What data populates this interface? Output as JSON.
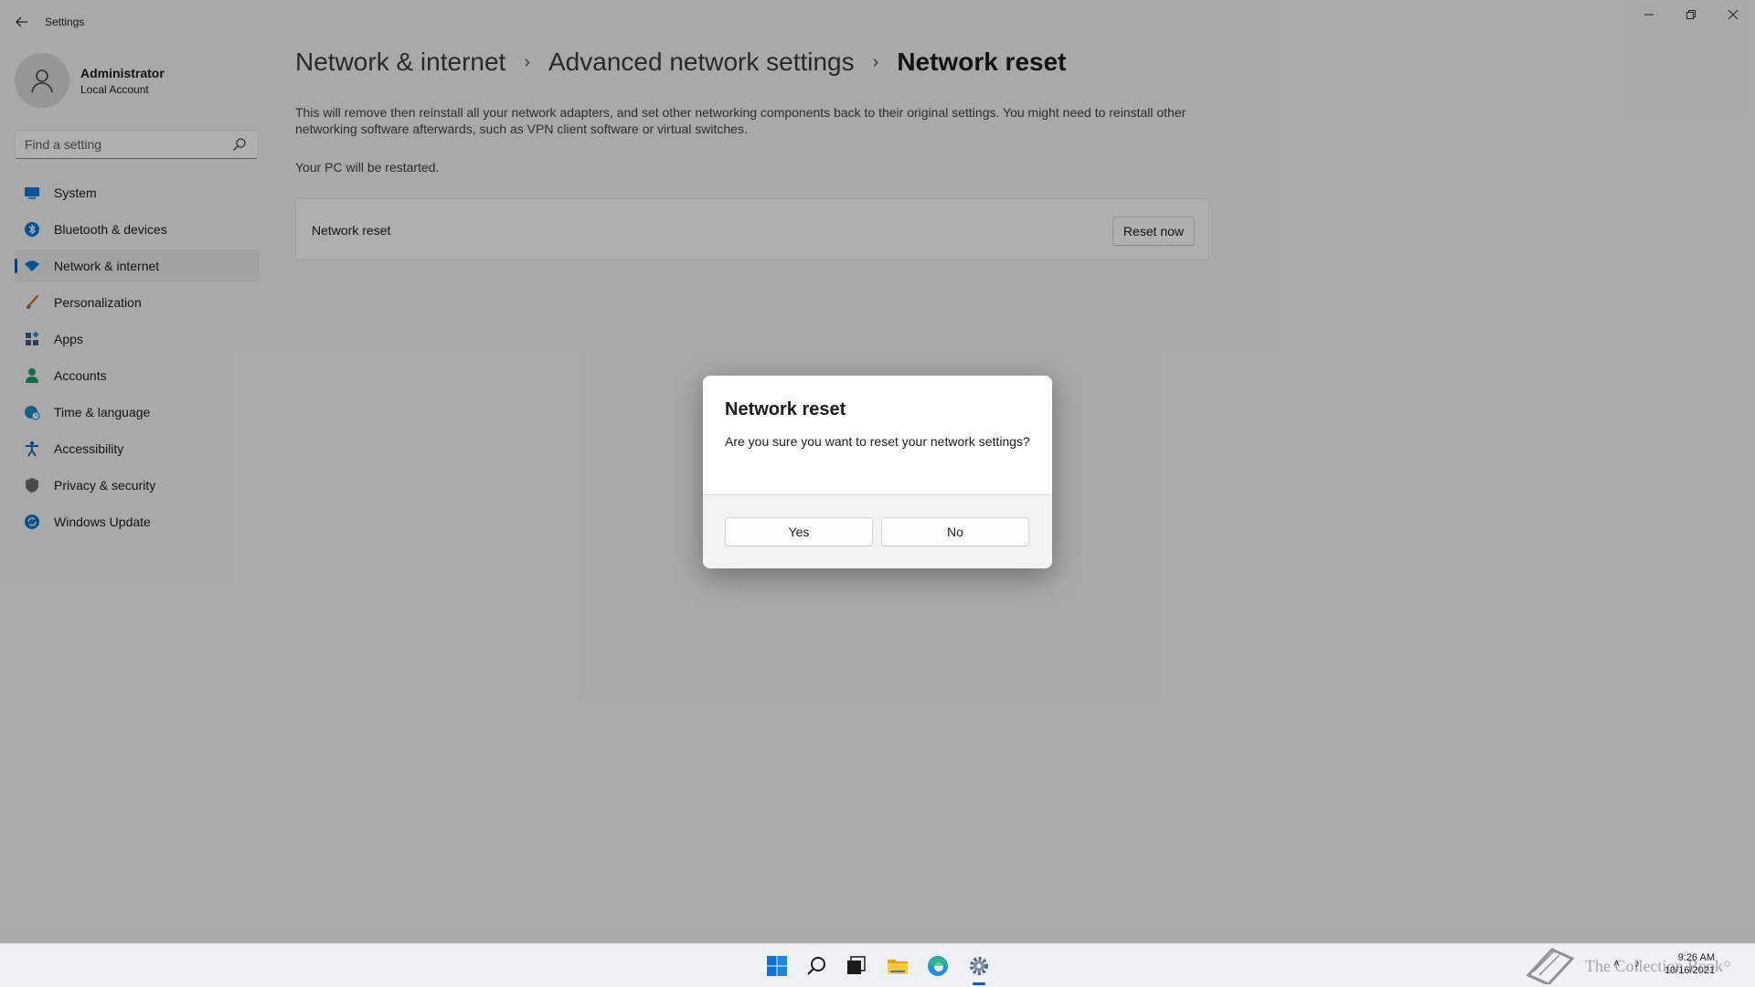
{
  "window": {
    "title": "Settings",
    "controls": {
      "minimize_icon": "minimize-icon",
      "restore_icon": "restore-icon",
      "close_icon": "close-icon"
    }
  },
  "profile": {
    "name": "Administrator",
    "account_type": "Local Account"
  },
  "search": {
    "placeholder": "Find a setting",
    "value": ""
  },
  "sidebar": {
    "items": [
      {
        "label": "System",
        "icon": "system-icon",
        "color": "#0078d4",
        "active": false
      },
      {
        "label": "Bluetooth & devices",
        "icon": "bluetooth-icon",
        "color": "#0078d4",
        "active": false
      },
      {
        "label": "Network & internet",
        "icon": "wifi-icon",
        "color": "#0078d4",
        "active": true
      },
      {
        "label": "Personalization",
        "icon": "brush-icon",
        "color": "#d86a16",
        "active": false
      },
      {
        "label": "Apps",
        "icon": "apps-icon",
        "color": "#4a5a75",
        "active": false
      },
      {
        "label": "Accounts",
        "icon": "person-icon",
        "color": "#1c9e6a",
        "active": false
      },
      {
        "label": "Time & language",
        "icon": "globe-clock-icon",
        "color": "#1a8bc9",
        "active": false
      },
      {
        "label": "Accessibility",
        "icon": "accessibility-icon",
        "color": "#0a5fb0",
        "active": false
      },
      {
        "label": "Privacy & security",
        "icon": "shield-icon",
        "color": "#6a6a6a",
        "active": false
      },
      {
        "label": "Windows Update",
        "icon": "update-icon",
        "color": "#0c74c8",
        "active": false
      }
    ]
  },
  "breadcrumb": {
    "items": [
      "Network & internet",
      "Advanced network settings"
    ],
    "current": "Network reset"
  },
  "content": {
    "description": "This will remove then reinstall all your network adapters, and set other networking components back to their original settings. You might need to reinstall other networking software afterwards, such as VPN client software or virtual switches.",
    "restart_note": "Your PC will be restarted.",
    "card": {
      "label": "Network reset",
      "button": "Reset now"
    }
  },
  "dialog": {
    "title": "Network reset",
    "message": "Are you sure you want to reset your network settings?",
    "yes": "Yes",
    "no": "No"
  },
  "taskbar": {
    "apps": [
      "start-icon",
      "search-icon",
      "task-view-icon",
      "file-explorer-icon",
      "edge-icon",
      "settings-icon"
    ],
    "watermark": "The Collection Book",
    "time": "9:26 AM",
    "date": "10/16/2021",
    "accent": "#005fb8"
  }
}
